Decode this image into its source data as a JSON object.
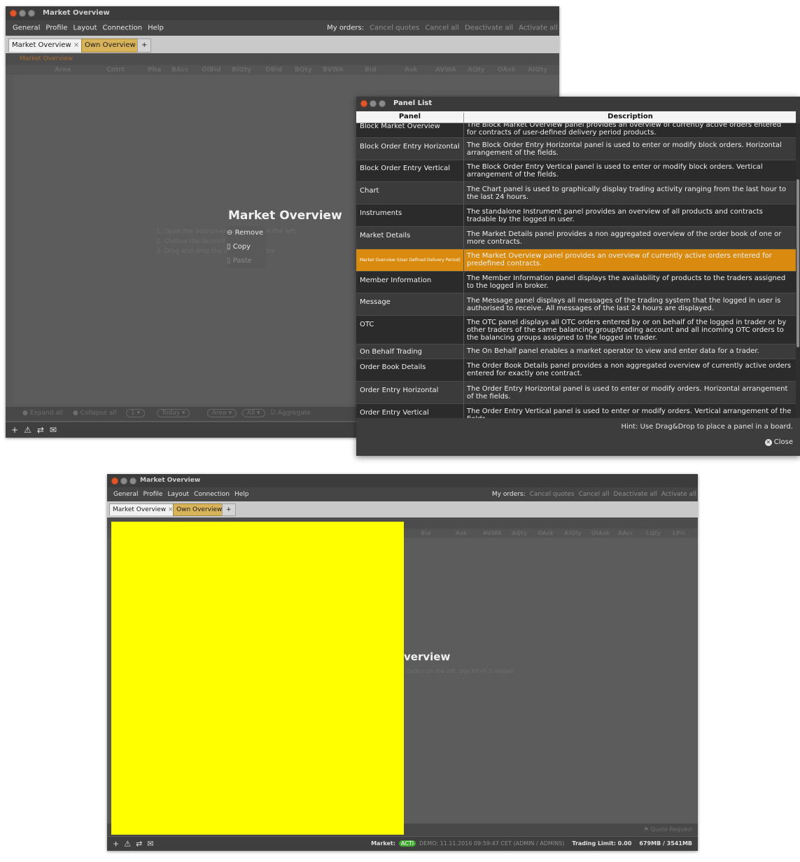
{
  "window_top": {
    "title": "Market Overview",
    "menu": [
      "General",
      "Profile",
      "Layout",
      "Connection",
      "Help"
    ],
    "my_orders_label": "My orders:",
    "order_actions": [
      "Cancel quotes",
      "Cancel all",
      "Deactivate all",
      "Activate all"
    ],
    "tabs": {
      "active": "Market Overview",
      "close": "×",
      "other": "Own Overview",
      "plus": "+"
    },
    "panel_header": "Market Overview",
    "columns": [
      "Area",
      "Cntrt",
      "Pha",
      "BAcc",
      "OIBid",
      "BIQty",
      "OBid",
      "BQty",
      "BVWA",
      "Bid",
      "Ask",
      "AVWA",
      "AQty",
      "OAsk",
      "AIQty"
    ],
    "big_title": "Market Overview",
    "context_menu": [
      "Remove",
      "Copy",
      "Paste"
    ],
    "help_lines": [
      "1.  Open the Instrument ... button on the left.",
      "2.  Choose the desired instrument",
      "3.  Drag and drop the instrument here"
    ],
    "bottom_controls": [
      "Expand all",
      "Collapse all",
      "1",
      "Today",
      "Area",
      "All",
      "Aggregate"
    ],
    "status_icons": [
      "+",
      "⚠",
      "⇄",
      "✉"
    ]
  },
  "panel_list": {
    "title": "Panel List",
    "headers": {
      "panel": "Panel",
      "description": "Description"
    },
    "rows": [
      {
        "panel": "Block Market Overview",
        "desc": "The Block Market Overview panel provides an overview of currently active orders entered for contracts of user-defined delivery period products."
      },
      {
        "panel": "Block Order Entry Horizontal",
        "desc": "The Block Order Entry Horizontal panel is used to enter or modify block orders. Horizontal arrangement of the fields."
      },
      {
        "panel": "Block Order Entry Vertical",
        "desc": "The Block Order Entry Vertical panel is used to enter or modify block orders. Vertical arrangement of the fields."
      },
      {
        "panel": "Chart",
        "desc": "The Chart panel is used to graphically display trading activity ranging from the last hour to the last 24 hours."
      },
      {
        "panel": "Instruments",
        "desc": "The standalone Instrument panel provides an overview of all products and contracts tradable by the logged in user."
      },
      {
        "panel": "Market Details",
        "desc": "The Market Details panel provides a non aggregated overview of the order book of one or more contracts."
      },
      {
        "panel": "Market Overview (User Defined Delivery Period)",
        "desc": "The Market Overview panel provides an overview of currently active orders entered for predefined contracts."
      },
      {
        "panel": "Member Information",
        "desc": "The Member Information panel displays the availability of products to the traders assigned to the logged in broker."
      },
      {
        "panel": "Message",
        "desc": "The Message panel displays all messages of the trading system that the logged in user is authorised to receive. All messages of the last 24 hours are displayed."
      },
      {
        "panel": "OTC",
        "desc": "The OTC panel displays all OTC orders entered by or on behalf of the logged in trader or by other traders of the same balancing group/trading account and all incoming OTC orders to the balancing groups assigned to the logged in trader."
      },
      {
        "panel": "On Behalf Trading",
        "desc": "The On Behalf panel enables a market operator to view and enter data for a trader."
      },
      {
        "panel": "Order Book Details",
        "desc": "The Order Book Details panel provides a non aggregated overview of currently active orders entered for exactly one contract."
      },
      {
        "panel": "Order Entry Horizontal",
        "desc": "The Order Entry Horizontal panel is used to enter or modify orders. Horizontal arrangement of the fields."
      },
      {
        "panel": "Order Entry Vertical",
        "desc": "The Order Entry Vertical panel is used to enter or modify orders. Vertical arrangement of the fields."
      }
    ],
    "hint": "Hint: Use Drag&Drop to place a panel in a board.",
    "close_label": "Close"
  },
  "window_bottom": {
    "title": "Market Overview",
    "menu": [
      "General",
      "Profile",
      "Layout",
      "Connection",
      "Help"
    ],
    "my_orders_label": "My orders:",
    "order_actions": [
      "Cancel quotes",
      "Cancel all",
      "Deactivate all",
      "Activate all"
    ],
    "tabs": {
      "active": "Market Overview",
      "close": "×",
      "other": "Own Overview",
      "plus": "+"
    },
    "columns": [
      "Bid",
      "Ask",
      "AVWA",
      "AQty",
      "OAsk",
      "AIQty",
      "OIAsk",
      "AAcc",
      "LQty",
      "LPri"
    ],
    "big_title_fragment": "verview",
    "help_fragment": "button on the left. Use Alt+F-5 hidden",
    "quote_request": "Quote Request",
    "status": {
      "market_label": "Market:",
      "market_badge": "ACTI",
      "session": "DEMO: 11.11.2016 09:59:47 CET (ADMIN / ADMINS)",
      "trading_limit": "Trading Limit: 0.00",
      "memory": "679MB / 3541MB"
    }
  },
  "colors": {
    "selection": "#d98b0f",
    "redaction": "#ffff00",
    "window_bg": "#595959",
    "badge": "#3fa82f"
  }
}
